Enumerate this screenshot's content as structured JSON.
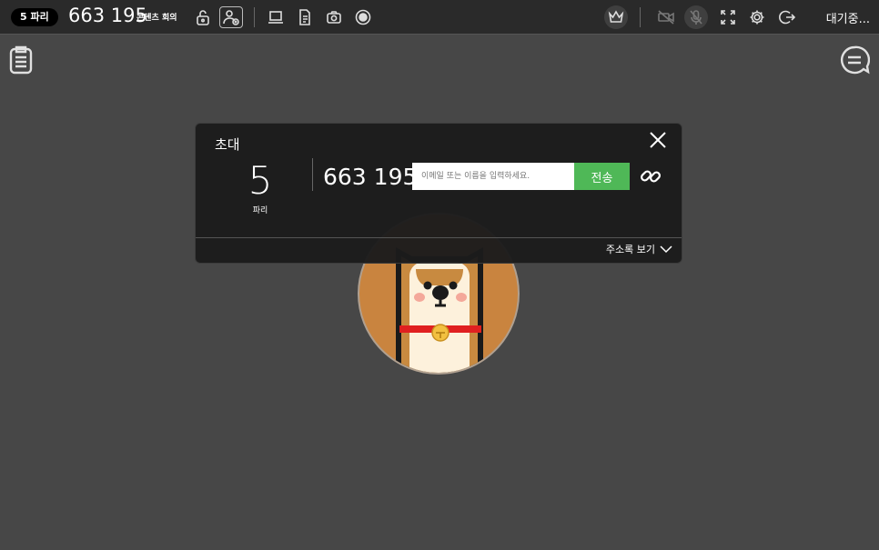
{
  "header": {
    "participants_badge": "5 파리",
    "room_number": "663 195",
    "room_name": "콘텐츠 회의",
    "status": "대기중..."
  },
  "icons": {
    "lock": "unlock-icon",
    "invite": "invite-user-icon",
    "screen_share": "laptop-icon",
    "document": "document-icon",
    "camera": "camera-icon",
    "record": "record-icon",
    "host": "crown-icon",
    "video_off": "video-off-icon",
    "mic_off": "mic-off-icon",
    "fullscreen": "fullscreen-icon",
    "settings": "gear-icon",
    "exit": "exit-icon"
  },
  "modal": {
    "title": "초대",
    "participant_count": "5",
    "participant_unit": "파리",
    "room_number": "663 195",
    "email_placeholder": "이메일 또는 이름을 입력하세요.",
    "send_label": "전송",
    "address_book_label": "주소록 보기"
  },
  "colors": {
    "background": "#474747",
    "topbar": "#2a2a2a",
    "send_button": "#4fb857",
    "avatar_bg": "#c9843f"
  }
}
